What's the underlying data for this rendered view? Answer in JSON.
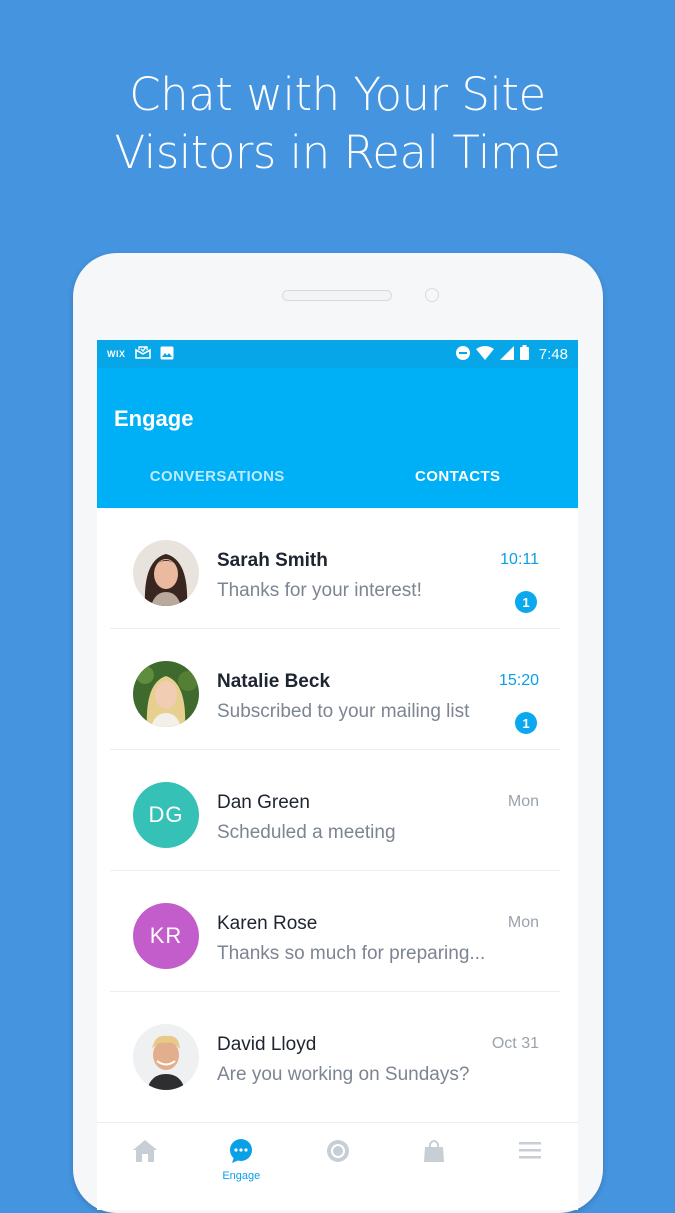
{
  "promo": {
    "line1": "Chat with Your Site",
    "line2": "Visitors in Real Time"
  },
  "statusbar": {
    "brand": "WIX",
    "time": "7:48"
  },
  "appbar": {
    "title": "Engage"
  },
  "tabs": [
    {
      "label": "CONVERSATIONS",
      "active": true
    },
    {
      "label": "CONTACTS",
      "active": false
    }
  ],
  "conversations": [
    {
      "name": "Sarah Smith",
      "preview": "Thanks for your interest!",
      "time": "10:11",
      "unread": "1",
      "avatar": "photo"
    },
    {
      "name": "Natalie Beck",
      "preview": "Subscribed to your mailing list",
      "time": "15:20",
      "unread": "1",
      "avatar": "photo"
    },
    {
      "name": "Dan Green",
      "preview": "Scheduled a meeting",
      "time": "Mon",
      "initials": "DG",
      "avatar_color": "#36c1b6"
    },
    {
      "name": "Karen Rose",
      "preview": "Thanks so much for preparing...",
      "time": "Mon",
      "initials": "KR",
      "avatar_color": "#c45dcc"
    },
    {
      "name": "David Lloyd",
      "preview": "Are you working on Sundays?",
      "time": "Oct 31",
      "avatar": "photo"
    }
  ],
  "bottomnav": [
    {
      "icon": "home-icon",
      "label": ""
    },
    {
      "icon": "chat-icon",
      "label": "Engage"
    },
    {
      "icon": "coin-icon",
      "label": ""
    },
    {
      "icon": "shopping-bag-icon",
      "label": ""
    },
    {
      "icon": "menu-icon",
      "label": ""
    }
  ],
  "colors": {
    "background": "#4594e0",
    "statusbar": "#06a6e8",
    "appbar": "#00b0f6",
    "accent": "#0aa0e6"
  }
}
